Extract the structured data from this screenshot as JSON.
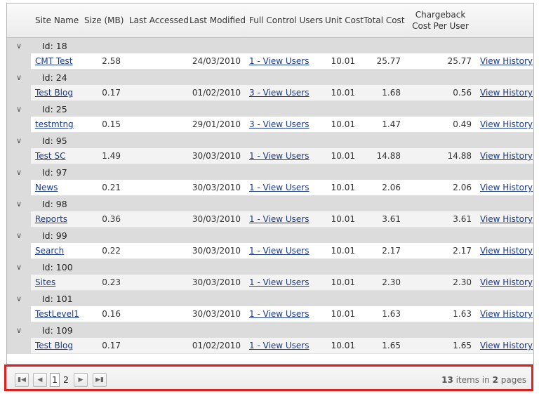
{
  "columns": {
    "site_name": "Site Name",
    "size": "Size (MB)",
    "last_accessed": "Last Accessed",
    "last_modified": "Last Modified",
    "full_control_users": "Full Control Users",
    "unit_cost": "Unit Cost",
    "total_cost": "Total Cost",
    "chargeback_line1": "Chargeback",
    "chargeback_line2": "Cost Per User"
  },
  "groups": [
    {
      "id_label": "Id: 18",
      "site": "CMT Test",
      "size": "2.58",
      "accessed": "",
      "modified": "24/03/2010",
      "users": "1 - View Users",
      "unit": "10.01",
      "total": "25.77",
      "per_user": "25.77",
      "history": "View History"
    },
    {
      "id_label": "Id: 24",
      "site": "Test Blog",
      "size": "0.17",
      "accessed": "",
      "modified": "01/02/2010",
      "users": "3 - View Users",
      "unit": "10.01",
      "total": "1.68",
      "per_user": "0.56",
      "history": "View History"
    },
    {
      "id_label": "Id: 25",
      "site": "testmtng",
      "size": "0.15",
      "accessed": "",
      "modified": "29/01/2010",
      "users": "3 - View Users",
      "unit": "10.01",
      "total": "1.47",
      "per_user": "0.49",
      "history": "View History"
    },
    {
      "id_label": "Id: 95",
      "site": "Test SC",
      "size": "1.49",
      "accessed": "",
      "modified": "30/03/2010",
      "users": "1 - View Users",
      "unit": "10.01",
      "total": "14.88",
      "per_user": "14.88",
      "history": "View History"
    },
    {
      "id_label": "Id: 97",
      "site": "News",
      "size": "0.21",
      "accessed": "",
      "modified": "30/03/2010",
      "users": "1 - View Users",
      "unit": "10.01",
      "total": "2.06",
      "per_user": "2.06",
      "history": "View History"
    },
    {
      "id_label": "Id: 98",
      "site": "Reports",
      "size": "0.36",
      "accessed": "",
      "modified": "30/03/2010",
      "users": "1 - View Users",
      "unit": "10.01",
      "total": "3.61",
      "per_user": "3.61",
      "history": "View History"
    },
    {
      "id_label": "Id: 99",
      "site": "Search",
      "size": "0.22",
      "accessed": "",
      "modified": "30/03/2010",
      "users": "1 - View Users",
      "unit": "10.01",
      "total": "2.17",
      "per_user": "2.17",
      "history": "View History"
    },
    {
      "id_label": "Id: 100",
      "site": "Sites",
      "size": "0.23",
      "accessed": "",
      "modified": "30/03/2010",
      "users": "1 - View Users",
      "unit": "10.01",
      "total": "2.30",
      "per_user": "2.30",
      "history": "View History"
    },
    {
      "id_label": "Id: 101",
      "site": "TestLevel1",
      "size": "0.16",
      "accessed": "",
      "modified": "30/03/2010",
      "users": "1 - View Users",
      "unit": "10.01",
      "total": "1.63",
      "per_user": "1.63",
      "history": "View History"
    },
    {
      "id_label": "Id: 109",
      "site": "Test Blog",
      "size": "0.17",
      "accessed": "",
      "modified": "01/02/2010",
      "users": "1 - View Users",
      "unit": "10.01",
      "total": "1.65",
      "per_user": "1.65",
      "history": "View History"
    }
  ],
  "pager": {
    "pages": [
      "1",
      "2"
    ],
    "current_page": "1",
    "item_count": "13",
    "items_in_text": "items in",
    "page_count": "2",
    "pages_text": "pages"
  },
  "icons": {
    "expand": "chevron-down-icon",
    "first": "first-page-icon",
    "prev": "prev-page-icon",
    "next": "next-page-icon",
    "last": "last-page-icon"
  },
  "colors": {
    "link": "#1a3a8a",
    "group_band": "#dcdcdc",
    "highlight_border": "#e02020"
  }
}
